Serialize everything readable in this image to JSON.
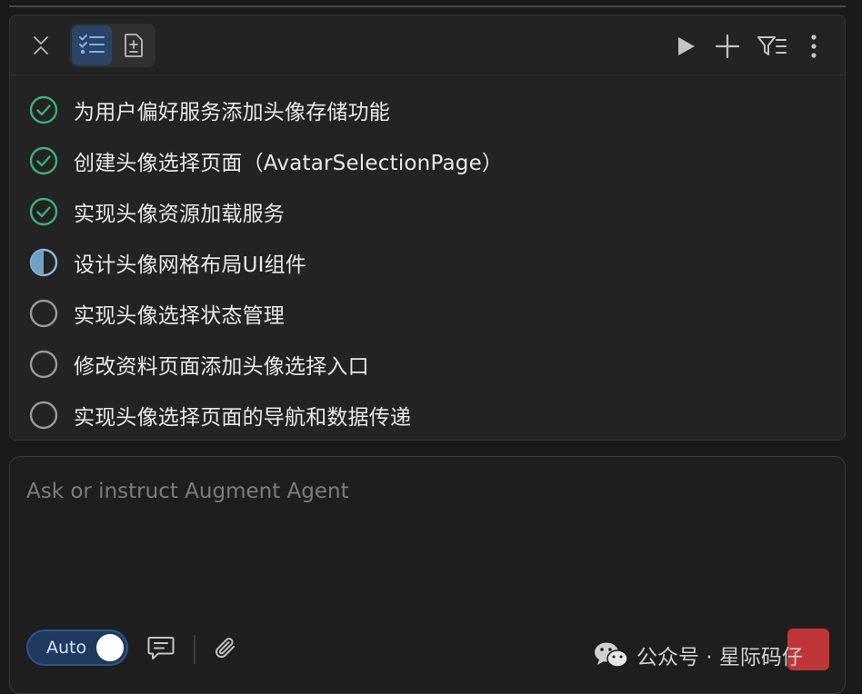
{
  "toolbar": {
    "collapse": "collapse-icon",
    "view_tasks": "task-list-icon",
    "view_doc": "add-document-icon",
    "run": "play-icon",
    "add": "plus-icon",
    "filter": "filter-icon",
    "more": "more-vertical-icon",
    "active_color": "#2a4366"
  },
  "tasks": [
    {
      "label": "为用户偏好服务添加头像存储功能",
      "status": "completed"
    },
    {
      "label": "创建头像选择页面（AvatarSelectionPage）",
      "status": "completed"
    },
    {
      "label": "实现头像资源加载服务",
      "status": "completed"
    },
    {
      "label": "设计头像网格布局UI组件",
      "status": "in-progress"
    },
    {
      "label": "实现头像选择状态管理",
      "status": "not-started"
    },
    {
      "label": "修改资料页面添加头像选择入口",
      "status": "not-started"
    },
    {
      "label": "实现头像选择页面的导航和数据传递",
      "status": "not-started"
    }
  ],
  "status_colors": {
    "completed": "#3fae7a",
    "in_progress": "#6ea3c9",
    "not_started": "#9a9a9a"
  },
  "input": {
    "value": "",
    "placeholder": "Ask or instruct Augment Agent"
  },
  "footer": {
    "auto_label": "Auto",
    "auto_enabled": true,
    "chat_icon": "chat-icon",
    "attach_icon": "paperclip-icon"
  },
  "watermark": {
    "text": "公众号 · 星际码仔"
  }
}
